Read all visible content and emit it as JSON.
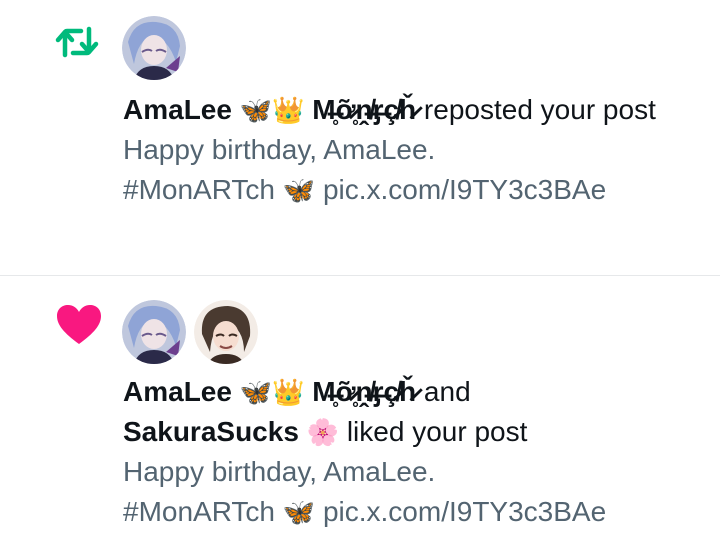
{
  "notifications": [
    {
      "type": "repost",
      "icon": "repost-icon",
      "icon_color": "#00ba7c",
      "avatars": [
        "amalee-avatar"
      ],
      "actor1_name": "AmaLee",
      "actor1_emoji": "🦋👑",
      "actor1_suffix": "M̶̥ỡ̷̥ṋ̸̶ᶉ̶ç̸̷̷ȟ̷",
      "action_text": " reposted your post",
      "snippet_line1": "Happy birthday, AmaLee.",
      "snippet_hashtag": "#MonARTch",
      "snippet_emoji": "🦋",
      "snippet_link": "pic.x.com/I9TY3c3BAe"
    },
    {
      "type": "like",
      "icon": "heart-icon",
      "icon_color": "#f91880",
      "avatars": [
        "amalee-avatar",
        "sakurasucks-avatar"
      ],
      "actor1_name": "AmaLee",
      "actor1_emoji": "🦋👑",
      "actor1_suffix": "M̶̥ỡ̷̥ṋ̸̶ᶉ̶ç̸̷̷ȟ̷",
      "connector": " and ",
      "actor2_name": "SakuraSucks",
      "actor2_emoji": "🌸",
      "action_text": " liked your post",
      "snippet_line1": "Happy birthday, AmaLee.",
      "snippet_hashtag": "#MonARTch",
      "snippet_emoji": "🦋",
      "snippet_link": "pic.x.com/I9TY3c3BAe"
    }
  ]
}
